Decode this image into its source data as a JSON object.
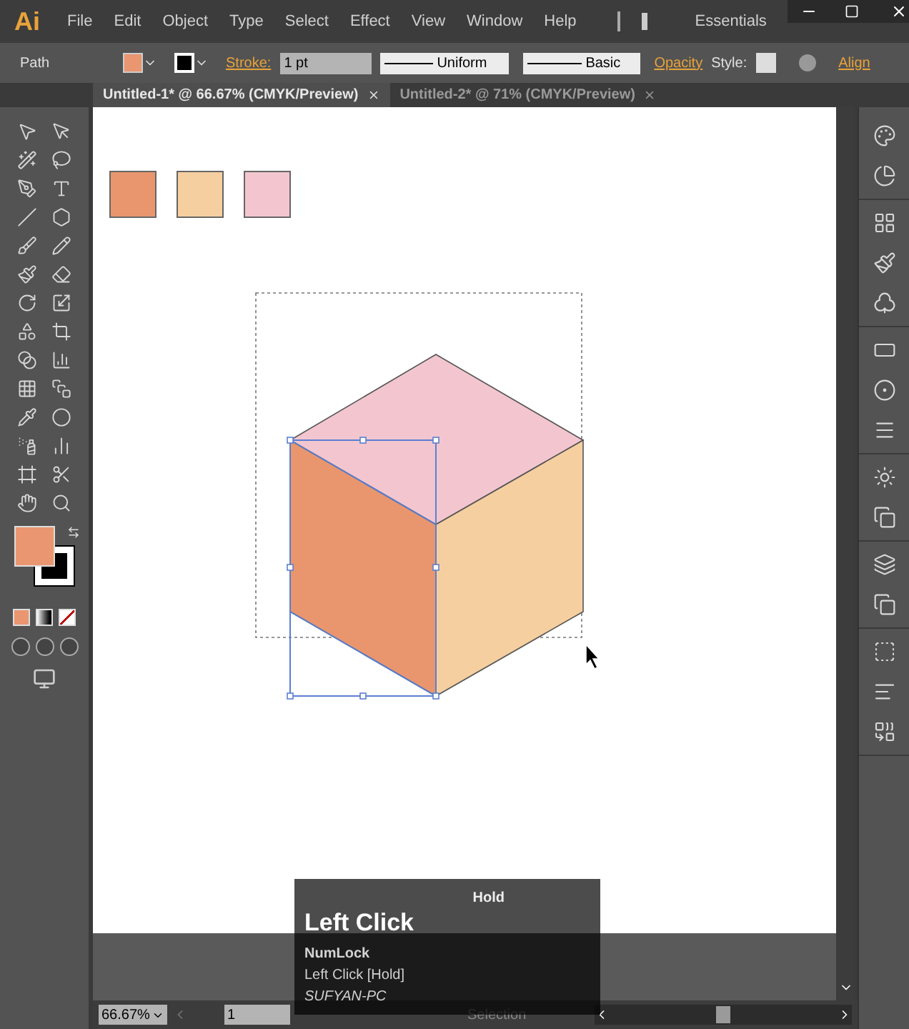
{
  "app": {
    "logo": "Ai",
    "workspace": "Essentials"
  },
  "menu": [
    "File",
    "Edit",
    "Object",
    "Type",
    "Select",
    "Effect",
    "View",
    "Window",
    "Help"
  ],
  "control_bar": {
    "selection_label": "Path",
    "stroke_label": "Stroke:",
    "stroke_weight": "1 pt",
    "profile": "Uniform",
    "brush": "Basic",
    "opacity_label": "Opacity",
    "style_label": "Style:",
    "align_label": "Align"
  },
  "tabs": [
    {
      "label": "Untitled-1* @ 66.67% (CMYK/Preview)",
      "selected": true
    },
    {
      "label": "Untitled-2* @ 71% (CMYK/Preview)",
      "selected": false
    }
  ],
  "swatches": [
    {
      "color": "#e9966f"
    },
    {
      "color": "#f6cfa0"
    },
    {
      "color": "#f3c6cf"
    }
  ],
  "key_overlay": {
    "hold_label": "Hold",
    "title": "Left Click",
    "lines": [
      {
        "text": "NumLock",
        "kind": "bold"
      },
      {
        "text": "Left Click [Hold]",
        "kind": "plain"
      },
      {
        "text": "SUFYAN-PC",
        "kind": "italic"
      }
    ]
  },
  "status_bar": {
    "zoom": "66.67%",
    "artboard": "1",
    "tool": "Selection"
  }
}
